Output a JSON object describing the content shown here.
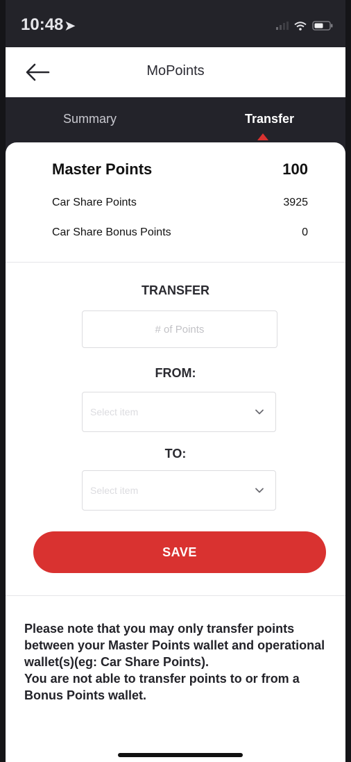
{
  "status_bar": {
    "time": "10:48",
    "icons": [
      "location-arrow-icon",
      "signal-icon",
      "wifi-icon",
      "battery-icon"
    ]
  },
  "nav": {
    "title": "MoPoints",
    "back_icon": "arrow-left-icon"
  },
  "tabs": [
    {
      "label": "Summary",
      "active": false
    },
    {
      "label": "Transfer",
      "active": true
    }
  ],
  "points": {
    "master": {
      "label": "Master Points",
      "value": "100"
    },
    "car_share": {
      "label": "Car Share Points",
      "value": "3925"
    },
    "car_share_bonus": {
      "label": "Car Share Bonus Points",
      "value": "0"
    }
  },
  "form": {
    "transfer_label": "TRANSFER",
    "points_placeholder": "# of Points",
    "from_label": "FROM:",
    "from_select": "Select item",
    "to_label": "TO:",
    "to_select": "Select item",
    "save_label": "SAVE"
  },
  "note": {
    "line1": "Please note that you may only transfer points between your Master Points wallet and operational wallet(s)(eg: Car Share Points).",
    "line2": "You are not able to transfer points to or from a Bonus Points wallet."
  },
  "colors": {
    "accent": "#d93230",
    "dark_header": "#23232a"
  }
}
